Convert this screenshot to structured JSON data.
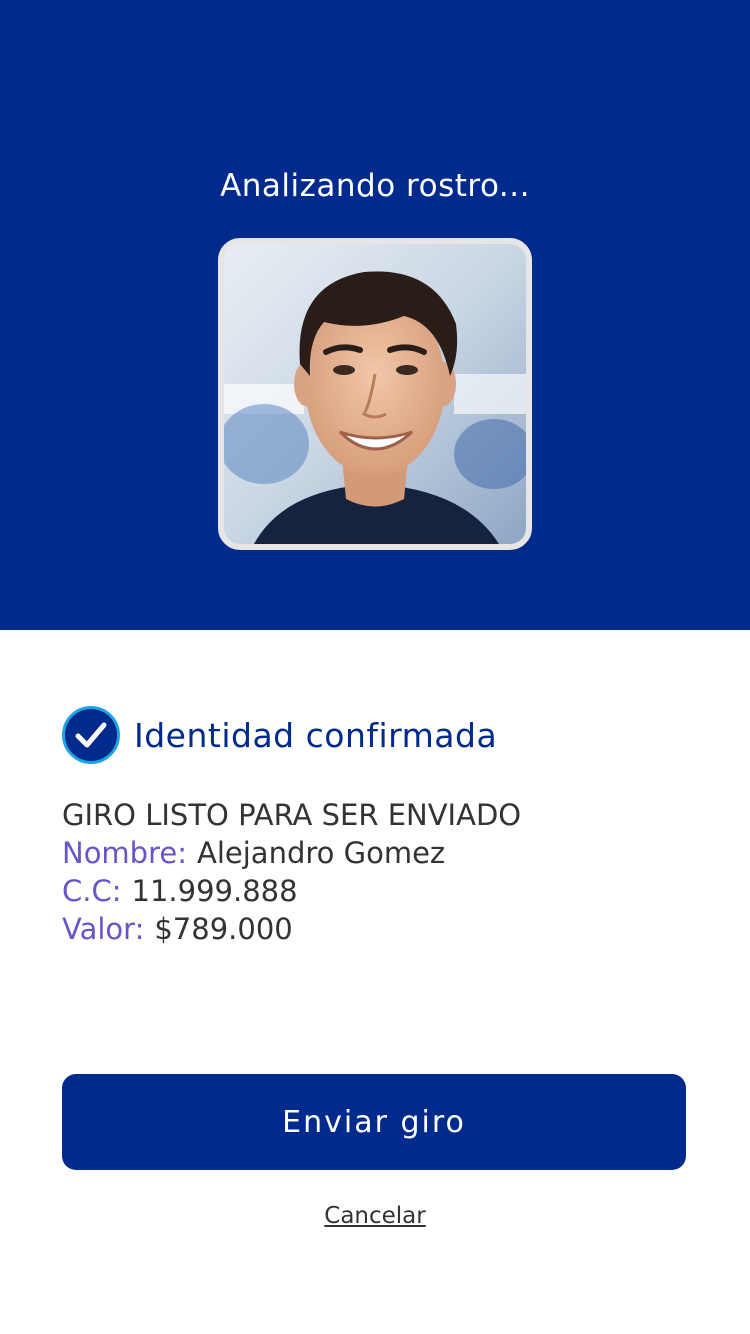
{
  "colors": {
    "primary": "#002a8c",
    "accent_label": "#6b54c9",
    "check_ring": "#1fa3e8",
    "text": "#333333"
  },
  "header": {
    "title": "Analizando rostro..."
  },
  "face_photo": {
    "icon": "face-photo"
  },
  "status": {
    "icon": "check-circle-icon",
    "label": "Identidad confirmada"
  },
  "details": {
    "heading": "GIRO LISTO PARA SER ENVIADO",
    "name_key": "Nombre:",
    "name_value": "Alejandro Gomez",
    "id_key": "C.C:",
    "id_value": "11.999.888",
    "amount_key": "Valor:",
    "amount_value": "$789.000"
  },
  "actions": {
    "send_label": "Enviar giro",
    "cancel_label": "Cancelar"
  }
}
